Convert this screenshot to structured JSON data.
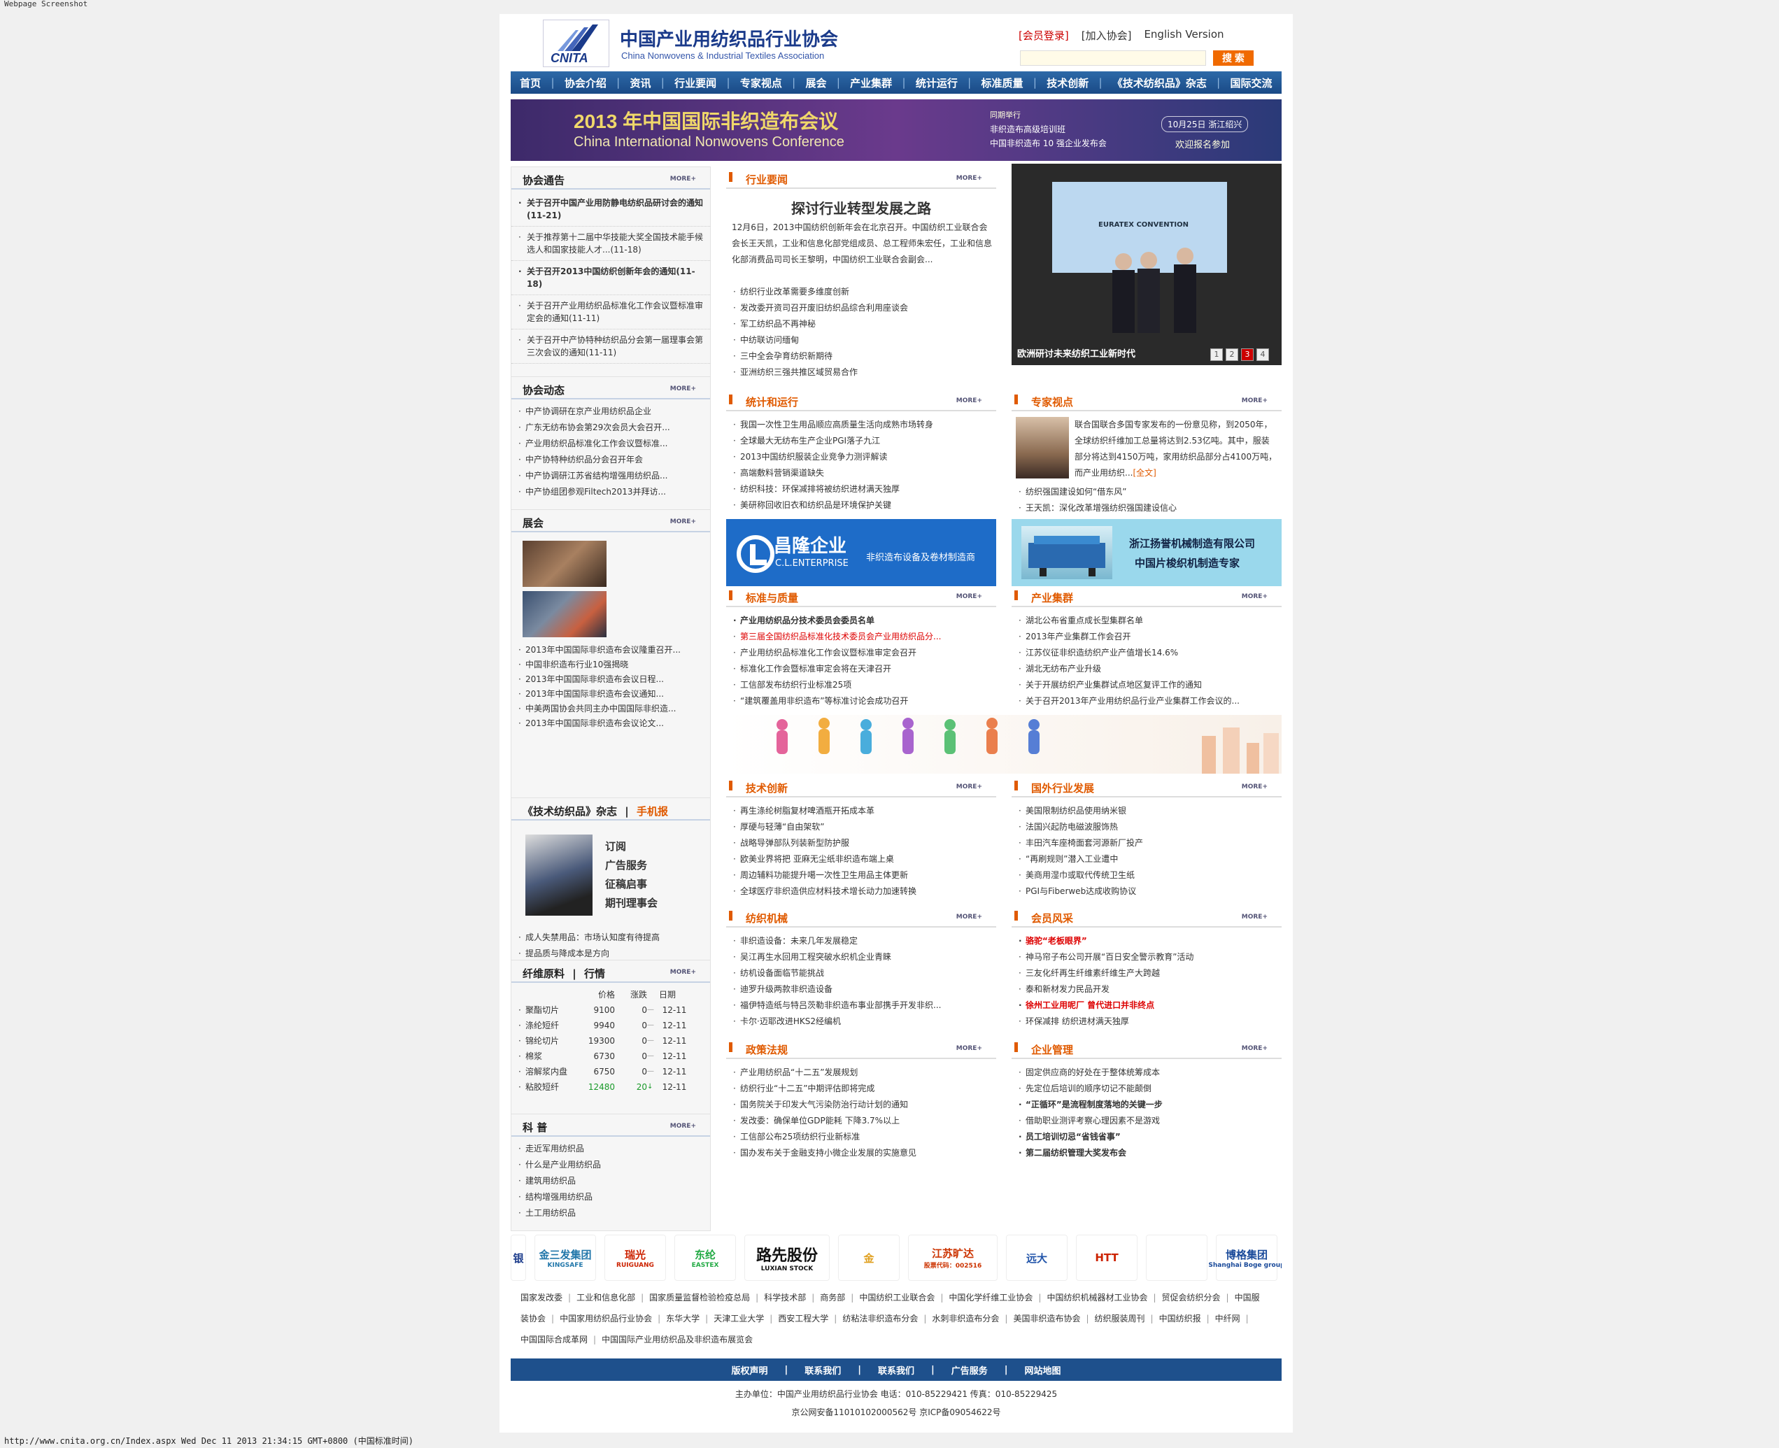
{
  "screenshot_label": "Webpage Screenshot",
  "footer_url": "http://www.cnita.org.cn/Index.aspx Wed Dec 11 2013 21:34:15 GMT+0800 (中国标准时间)",
  "logo": {
    "abbr": "CNITA",
    "cn": "中国产业用纺织品行业协会",
    "en": "China Nonwovens & Industrial Textiles Association"
  },
  "toplinks": {
    "login": "[会员登录]",
    "join": "[加入协会]",
    "english": "English Version"
  },
  "search": {
    "button": "搜 索",
    "placeholder": ""
  },
  "nav": [
    "首页",
    "协会介绍",
    "资讯",
    "行业要闻",
    "专家视点",
    "展会",
    "产业集群",
    "统计运行",
    "标准质量",
    "技术创新",
    "《技术纺织品》杂志",
    "国际交流"
  ],
  "banner": {
    "line1": "2013 年中国国际非织造布会议",
    "line2": "China International Nonwovens Conference",
    "r1": "同期举行",
    "r2": "非织造布高级培训班",
    "r3": "中国非织造布 10 强企业发布会",
    "date": "10月25日  浙江绍兴",
    "join": "欢迎报名参加"
  },
  "more_label": "MORE+",
  "notice": {
    "title": "协会通告",
    "items": [
      {
        "text": "关于召开中国产业用防静电纺织品研讨会的通知(11-21)",
        "bold": true
      },
      {
        "text": "关于推荐第十二届中华技能大奖全国技术能手候选人和国家技能人才...(11-18)",
        "bold": false
      },
      {
        "text": "关于召开2013中国纺织创新年会的通知(11-18)",
        "bold": true
      },
      {
        "text": "关于召开产业用纺织品标准化工作会议暨标准审定会的通知(11-11)",
        "bold": false
      },
      {
        "text": "关于召开中产协特种纺织品分会第一届理事会第三次会议的通知(11-11)",
        "bold": false
      }
    ]
  },
  "dynamics": {
    "title": "协会动态",
    "items": [
      "中产协调研在京产业用纺织品企业",
      "广东无纺布协会第29次会员大会召开...",
      "产业用纺织品标准化工作会议暨标准...",
      "中产协特种纺织品分会召开年会",
      "中产协调研江苏省结构增强用纺织品...",
      "中产协组团参观Filtech2013并拜访..."
    ]
  },
  "expo": {
    "title": "展会",
    "items": [
      "2013年中国国际非织造布会议隆重召开...",
      "中国非织造布行业10强揭晓",
      "2013年中国国际非织造布会议日程...",
      "2013年中国国际非织造布会议通知...",
      "中美两国协会共同主办中国国际非织造...",
      "2013年中国国际非织造布会议论文..."
    ]
  },
  "magazine": {
    "title": "《技术纺织品》杂志",
    "sep": "|",
    "mobile": "手机报",
    "links": [
      "订阅",
      "广告服务",
      "征稿启事",
      "期刊理事会"
    ],
    "items": [
      "成人失禁用品：市场认知度有待提高",
      "提品质与降成本是方向"
    ]
  },
  "market": {
    "title": "纤维原料",
    "sep": "|",
    "title2": "行情",
    "headers": [
      "价格",
      "涨跌",
      "日期"
    ],
    "rows": [
      {
        "name": "聚酯切片",
        "price": "9100",
        "change": "0",
        "date": "12-11"
      },
      {
        "name": "涤纶短纤",
        "price": "9940",
        "change": "0",
        "date": "12-11"
      },
      {
        "name": "锦纶切片",
        "price": "19300",
        "change": "0",
        "date": "12-11"
      },
      {
        "name": "棉浆",
        "price": "6730",
        "change": "0",
        "date": "12-11"
      },
      {
        "name": "溶解浆内盘",
        "price": "6750",
        "change": "0",
        "date": "12-11"
      },
      {
        "name": "粘胶短纤",
        "price": "12480",
        "change": "20",
        "date": "12-11"
      }
    ]
  },
  "science": {
    "title": "科 普",
    "items": [
      "走近军用纺织品",
      "什么是产业用纺织品",
      "建筑用纺织品",
      "结构增强用纺织品",
      "土工用纺织品"
    ]
  },
  "news": {
    "title": "行业要闻",
    "headline": "探讨行业转型发展之路",
    "summary": "12月6日，2013中国纺织创新年会在北京召开。中国纺织工业联合会会长王天凯，工业和信息化部党组成员、总工程师朱宏任，工业和信息化部消费品司司长王黎明，中国纺织工业联合会副会...",
    "items": [
      "纺织行业改革需要多维度创新",
      "发改委开资司召开废旧纺织品综合利用座谈会",
      "军工纺织品不再神秘",
      "中纺联访问缅甸",
      "三中全会孕育纺织新期待",
      "亚洲纺织三强共推区域贸易合作"
    ]
  },
  "photo": {
    "caption": "欧洲研讨未来纺织工业新时代",
    "pages": [
      "1",
      "2",
      "3",
      "4"
    ],
    "screen_text": "EURATEX CONVENTION"
  },
  "stats": {
    "title": "统计和运行",
    "items": [
      "我国一次性卫生用品顺应高质量生活向成熟市场转身",
      "全球最大无纺布生产企业PGI落子九江",
      "2013中国纺织服装企业竞争力测评解读",
      "高端敷料营销渠道缺失",
      "纺织科技：环保减排将被纺织进材满天独厚",
      "美研称回收旧衣和纺织品是环境保护关键"
    ]
  },
  "expert": {
    "title": "专家视点",
    "summary": "联合国联合多国专家发布的一份意见称，到2050年，全球纺织纤维加工总量将达到2.53亿吨。其中，服装部分将达到4150万吨，家用纺织品部分占4100万吨，而产业用纺织...",
    "full": "[全文]",
    "items": [
      "纺织强国建设如何“借东风”",
      "王天凯：深化改革增强纺织强国建设信心"
    ]
  },
  "ad1": {
    "name": "昌隆企业",
    "en": "C.L.ENTERPRISE",
    "slogan": "非织造布设备及卷材制造商"
  },
  "ad2": {
    "name": "浙江扬誉机械制造有限公司",
    "slogan": "中国片梭织机制造专家"
  },
  "standards": {
    "title": "标准与质量",
    "items": [
      {
        "text": "产业用纺织品分技术委员会委员名单",
        "style": "bold"
      },
      {
        "text": "第三届全国纺织品标准化技术委员会产业用纺织品分...",
        "style": "red"
      },
      {
        "text": "产业用纺织品标准化工作会议暨标准审定会召开",
        "style": ""
      },
      {
        "text": "标准化工作会暨标准审定会将在天津召开",
        "style": ""
      },
      {
        "text": "工信部发布纺织行业标准25项",
        "style": ""
      },
      {
        "text": "“建筑覆盖用非织造布”等标准讨论会成功召开",
        "style": ""
      }
    ]
  },
  "cluster": {
    "title": "产业集群",
    "items": [
      "湖北公布省重点成长型集群名单",
      "2013年产业集群工作会召开",
      "江苏仪征非织造纺织产业产值增长14.6%",
      "湖北无纺布产业升级",
      "关于开展纺织产业集群试点地区复评工作的通知",
      "关于召开2013年产业用纺织品行业产业集群工作会议的..."
    ]
  },
  "tech": {
    "title": "技术创新",
    "items": [
      "再生涤纶树脂复材啤酒瓶开拓成本革",
      "厚硬与轻薄“自由架软”",
      "战略导弹部队列装新型防护服",
      "欧美业界将把 亚麻无尘纸非织造布端上桌",
      "周边辅料功能提升噶一次性卫生用品主体更新",
      "全球医疗非织造供应材料技术增长动力加速转换"
    ]
  },
  "foreign": {
    "title": "国外行业发展",
    "items": [
      "美国限制纺织品使用纳米银",
      "法国兴起防电磁波服饰热",
      "丰田汽车座椅面套河源新厂投产",
      "“再刷规则”潜入工业遭中",
      "美商用湿巾或取代传统卫生纸",
      "PGI与Fiberweb达成收购协议"
    ]
  },
  "machinery": {
    "title": "纺织机械",
    "items": [
      "非织造设备：未来几年发展稳定",
      "吴江再生水回用工程突破水织机企业青睐",
      "纺机设备面临节能挑战",
      "迪罗升级两款非织造设备",
      "福伊特造纸与特吕茨勒非织造布事业部携手开发非织...",
      "卡尔·迈耶改进HKS2经编机"
    ]
  },
  "members": {
    "title": "会员风采",
    "items": [
      {
        "text": "骆驼“老板眼界”",
        "style": "bold-red"
      },
      {
        "text": "神马帘子布公司开展“百日安全警示教育”活动",
        "style": ""
      },
      {
        "text": "三友化纤再生纤维素纤维生产大跨越",
        "style": ""
      },
      {
        "text": "泰和新材发力民品开发",
        "style": ""
      },
      {
        "text": "徐州工业用呢厂 曾代进口并非终点",
        "style": "bold-red"
      },
      {
        "text": "环保减排 纺织进材满天独厚",
        "style": ""
      }
    ]
  },
  "policy": {
    "title": "政策法规",
    "items": [
      "产业用纺织品“十二五”发展规划",
      "纺织行业“十二五”中期评估即将完成",
      "国务院关于印发大气污染防治行动计划的通知",
      "发改委：确保单位GDP能耗 下降3.7%以上",
      "工信部公布25项纺织行业新标准",
      "国办发布关于金融支持小微企业发展的实施意见"
    ]
  },
  "management": {
    "title": "企业管理",
    "items": [
      {
        "text": "固定供应商的好处在于整体统筹成本",
        "style": ""
      },
      {
        "text": "先定位后培训的顺序切记不能颠倒",
        "style": ""
      },
      {
        "text": "“正循环”是流程制度落地的关键一步",
        "style": "bold"
      },
      {
        "text": "借助职业测评考察心理因素不是游戏",
        "style": ""
      },
      {
        "text": "员工培训切忌“省钱省事”",
        "style": "bold"
      },
      {
        "text": "第二届纺织管理大奖发布会",
        "style": "bold"
      }
    ]
  },
  "partners": [
    {
      "name": "银",
      "en": "",
      "color": "#1a3a8a"
    },
    {
      "name": "金三发集团",
      "en": "KINGSAFE",
      "color": "#2277aa"
    },
    {
      "name": "瑞光",
      "en": "RUIGUANG",
      "color": "#cc2200"
    },
    {
      "name": "东纶",
      "en": "EASTEX",
      "color": "#22aa44"
    },
    {
      "name": "路先股份",
      "en": "LUXIAN STOCK",
      "color": "#111111"
    },
    {
      "name": "金",
      "en": "",
      "color": "#e0a020"
    },
    {
      "name": "江苏旷达",
      "en": "股票代码：002516",
      "color": "#cc3300"
    },
    {
      "name": "远大",
      "en": "",
      "color": "#2255aa"
    },
    {
      "name": "HTT",
      "en": "",
      "color": "#cc2200"
    },
    {
      "name": "",
      "en": "",
      "color": "#2277cc"
    },
    {
      "name": "博格集团",
      "en": "Shanghai Boge group",
      "color": "#1a4a9a"
    }
  ],
  "links": [
    "国家发改委",
    "工业和信息化部",
    "国家质量监督检验检疫总局",
    "科学技术部",
    "商务部",
    "中国纺织工业联合会",
    "中国化学纤维工业协会",
    "中国纺织机械器材工业协会",
    "贸促会纺织分会",
    "中国服装协会",
    "中国家用纺织品行业协会",
    "东华大学",
    "天津工业大学",
    "西安工程大学",
    "纺粘法非织造布分会",
    "水刺非织造布分会",
    "美国非织造布协会",
    "纺织服装周刊",
    "中国纺织报",
    "中纤网",
    "中国国际合成革网",
    "中国国际产业用纺织品及非织造布展览会"
  ],
  "footer": {
    "bar": [
      "版权声明",
      "联系我们",
      "联系我们",
      "广告服务",
      "网站地图"
    ],
    "bar_sep": "|",
    "info": "主办单位：中国产业用纺织品行业协会  电话：010-85229421  传真：010-85229425",
    "icp": "京公网安备11010102000562号  京ICP备09054622号"
  }
}
